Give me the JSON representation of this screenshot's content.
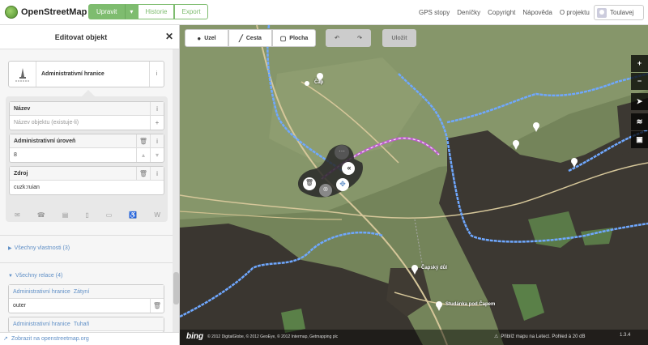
{
  "app": {
    "name": "OpenStreetMap",
    "edit_label": "Upravit",
    "history_label": "Historie",
    "export_label": "Export"
  },
  "top_links": [
    "GPS stopy",
    "Deníčky",
    "Copyright",
    "Nápověda",
    "O projektu"
  ],
  "user": {
    "name": "Toulavej"
  },
  "sidebar": {
    "title": "Editovat objekt",
    "preset_label": "Administrativní hranice",
    "fields": {
      "name_label": "Název",
      "name_placeholder": "Název objektu (existuje-li)",
      "admin_level_label": "Administrativní úroveň",
      "admin_level_value": "8",
      "source_label": "Zdroj",
      "source_value": "cuzk:ruian"
    },
    "all_tags_label": "Všechny vlastnosti (3)",
    "all_relations_label": "Všechny relace (4)",
    "relations": [
      {
        "type": "Administrativní hranice",
        "name": "Zátyní",
        "role": "outer"
      },
      {
        "type": "Administrativní hranice",
        "name": "Tuhaň",
        "role": ""
      }
    ],
    "footer_link": "Zobrazit na openstreetmap.org"
  },
  "map": {
    "toolbar": {
      "point": "Uzel",
      "line": "Cesta",
      "area": "Plocha",
      "save": "Uložit"
    },
    "labels": {
      "place1": "Čap",
      "place2": "Čapský důl",
      "place3": "Studánka pod Čapem"
    },
    "footer": {
      "brand": "bing",
      "attribution": "© 2012 DigitalGlobe, © 2012 GeoEye, © 2012 Intermap, Getmapping plc",
      "status": "Přiblíž mapu na Letect. Pohled à 20 dB",
      "version": "1.3.4"
    }
  },
  "colors": {
    "osm_green": "#7ebc6f",
    "link_blue": "#5f8fc6",
    "boundary_blue": "#6fa8ff",
    "selected_purple": "#c060d0"
  }
}
